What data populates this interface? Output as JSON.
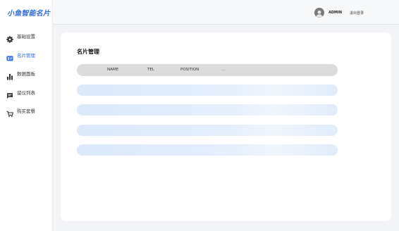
{
  "app": {
    "logo_text": "小鱼智能名片"
  },
  "sidebar": {
    "items": [
      {
        "label": "基础设置",
        "icon": "gear-icon",
        "active": false
      },
      {
        "label": "名片管理",
        "icon": "card-icon",
        "active": true
      },
      {
        "label": "数据面板",
        "icon": "bar-chart-icon",
        "active": false
      },
      {
        "label": "留仪列表",
        "icon": "message-icon",
        "active": false
      },
      {
        "label": "购买套餐",
        "icon": "cart-icon",
        "active": false
      }
    ]
  },
  "header": {
    "user_name": "ADMIN",
    "logout_label": "退出登录"
  },
  "main": {
    "title": "名片管理",
    "columns": [
      "NAME",
      "TEL",
      "POSITION",
      "..."
    ],
    "loading_rows": 4
  },
  "colors": {
    "accent": "#2f6bf0",
    "skeleton": "#dde9fb",
    "header_row": "#dcdcdc"
  }
}
